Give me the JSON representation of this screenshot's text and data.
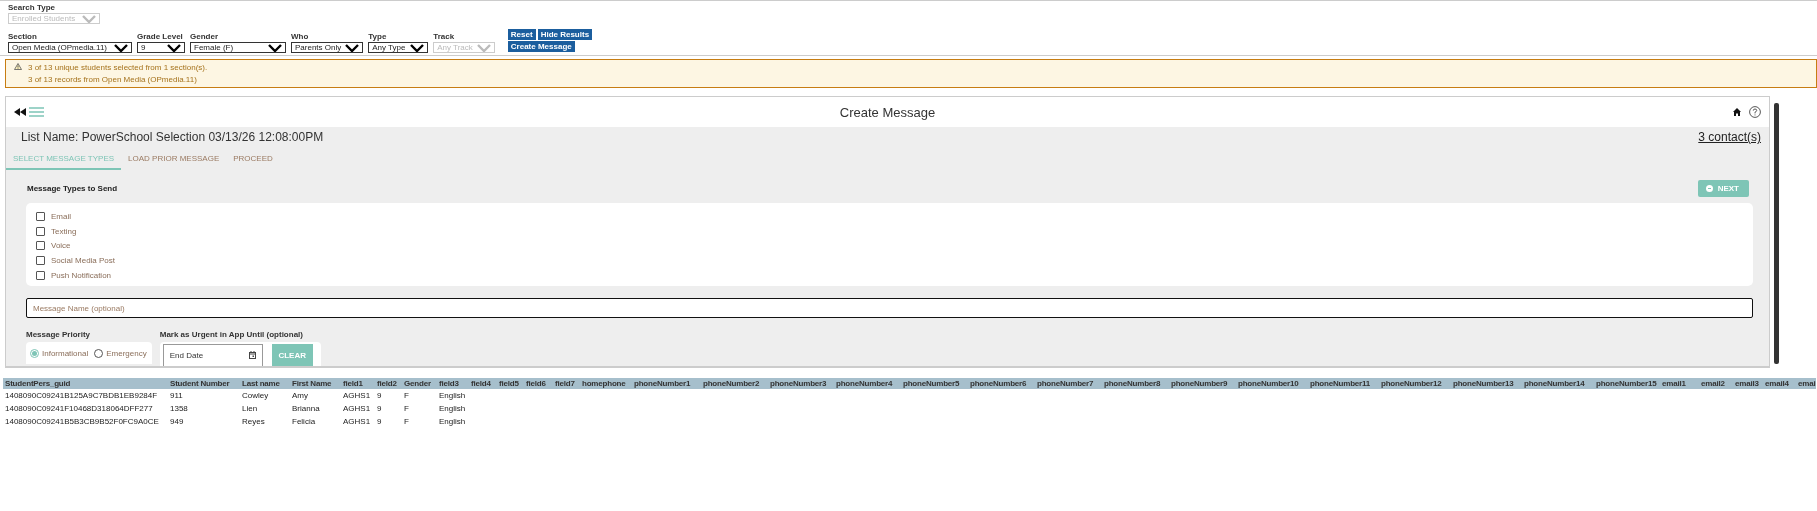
{
  "filters": {
    "search_type": {
      "label": "Search Type",
      "value": "Enrolled Students",
      "disabled": true
    },
    "selects": [
      {
        "label": "Section",
        "value": "Open Media (OPmedia.11)",
        "disabled": false
      },
      {
        "label": "Grade Level",
        "value": "9",
        "disabled": false
      },
      {
        "label": "Gender",
        "value": "Female (F)",
        "disabled": false
      },
      {
        "label": "Who",
        "value": "Parents Only",
        "disabled": false
      },
      {
        "label": "Type",
        "value": "Any Type",
        "disabled": false
      },
      {
        "label": "Track",
        "value": "Any Track",
        "disabled": true
      }
    ],
    "buttons": [
      "Reset",
      "Hide Results",
      "Create Message"
    ]
  },
  "alert": {
    "lines": [
      "3 of 13 unique students selected from 1 section(s).",
      "3 of 13 records from Open Media (OPmedia.11)"
    ]
  },
  "card": {
    "title": "Create Message",
    "list_name": "List Name: PowerSchool Selection 03/13/26 12:08:00PM",
    "contacts": "3 contact(s)",
    "tabs": [
      {
        "label": "SELECT MESSAGE TYPES",
        "selected": true
      },
      {
        "label": "LOAD PRIOR MESSAGE",
        "selected": false
      },
      {
        "label": "PROCEED",
        "selected": false
      }
    ],
    "section_title": "Message Types to Send",
    "next_button": "NEXT",
    "message_types": [
      {
        "label": "Email",
        "checked": false
      },
      {
        "label": "Texting",
        "checked": false
      },
      {
        "label": "Voice",
        "checked": false
      },
      {
        "label": "Social Media Post",
        "checked": false
      },
      {
        "label": "Push Notification",
        "checked": false
      }
    ],
    "message_name": {
      "placeholder": "Message Name (optional)"
    },
    "priority": {
      "label": "Message Priority",
      "options": [
        {
          "label": "Informational",
          "selected": true
        },
        {
          "label": "Emergency",
          "selected": false
        }
      ]
    },
    "urgent": {
      "label": "Mark as Urgent in App Until (optional)",
      "end_date": {
        "placeholder": "End Date"
      },
      "clear_button": "CLEAR"
    }
  },
  "table": {
    "columns": [
      "StudentPers_guid",
      "Student Number",
      "Last name",
      "First Name",
      "field1",
      "field2",
      "Gender",
      "field3",
      "field4",
      "field5",
      "field6",
      "field7",
      "homephone",
      "phoneNumber1",
      "phoneNumber2",
      "phoneNumber3",
      "phoneNumber4",
      "phoneNumber5",
      "phoneNumber6",
      "phoneNumber7",
      "phoneNumber8",
      "phoneNumber9",
      "phoneNumber10",
      "phoneNumber11",
      "phoneNumber12",
      "phoneNumber13",
      "phoneNumber14",
      "phoneNumber15",
      "email1",
      "email2",
      "email3",
      "email4",
      "emai"
    ],
    "rows": [
      [
        "1408090C09241B125A9C7BDB1EB9284F",
        "911",
        "Cowley",
        "Amy",
        "AGHS1",
        "9",
        "F",
        "English"
      ],
      [
        "1408090C09241F10468D318064DFF277",
        "1358",
        "Lien",
        "Brianna",
        "AGHS1",
        "9",
        "F",
        "English"
      ],
      [
        "1408090C09241B5B3CB9B52F0FC9A0CE",
        "949",
        "Reyes",
        "Felicia",
        "AGHS1",
        "9",
        "F",
        "English"
      ]
    ]
  }
}
